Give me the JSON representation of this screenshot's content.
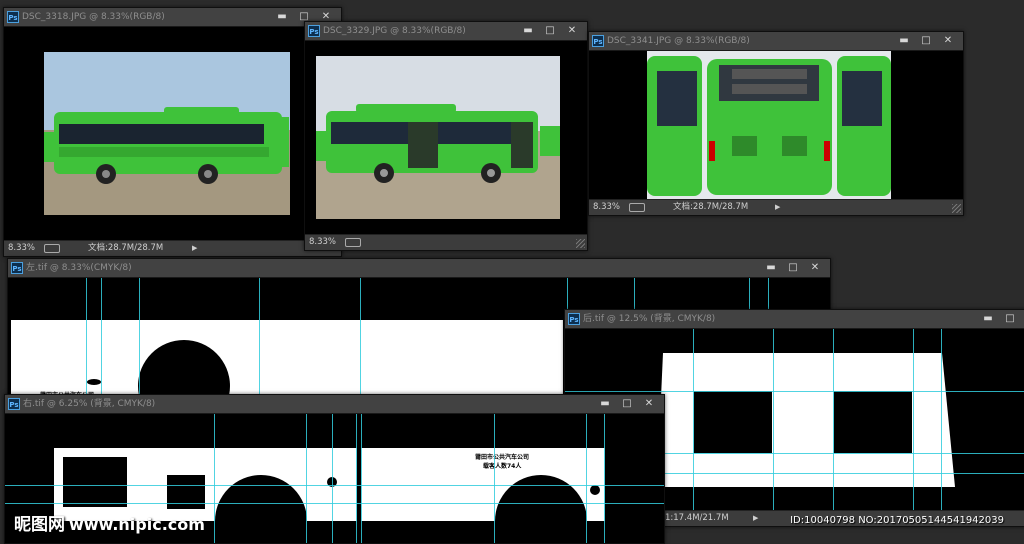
{
  "windows": {
    "w3318": {
      "title": "DSC_3318.JPG @ 8.33%(RGB/8)",
      "zoom": "8.33%",
      "doc": "文档:28.7M/28.7M"
    },
    "w3329": {
      "title": "DSC_3329.JPG @ 8.33%(RGB/8)",
      "zoom": "8.33%",
      "doc": ""
    },
    "w3341": {
      "title": "DSC_3341.JPG @ 8.33%(RGB/8)",
      "zoom": "8.33%",
      "doc": "文档:28.7M/28.7M"
    },
    "wleft": {
      "title": "左.tif @ 8.33%(CMYK/8)",
      "label": "莆田市公共汽车公司"
    },
    "wback": {
      "title": "后.tif @ 12.5% (背景, CMYK/8)",
      "doc": "1:17.4M/21.7M"
    },
    "wright": {
      "title": "右.tif @ 6.25% (背景, CMYK/8)",
      "company": "莆田市公共汽车公司",
      "capacity": "载客人数74人"
    }
  },
  "controls": {
    "minimize": "▬",
    "maximize": "□",
    "close": "✕"
  },
  "watermark": {
    "brand": "昵图网",
    "site": "www.nipic.com",
    "id": "ID:10040798 NO:20170505144541942039"
  },
  "colors": {
    "bus_green": "#3fc23a",
    "guide": "#33ccdd",
    "titlebar": "#424242",
    "workspace": "#2b2b2b"
  }
}
